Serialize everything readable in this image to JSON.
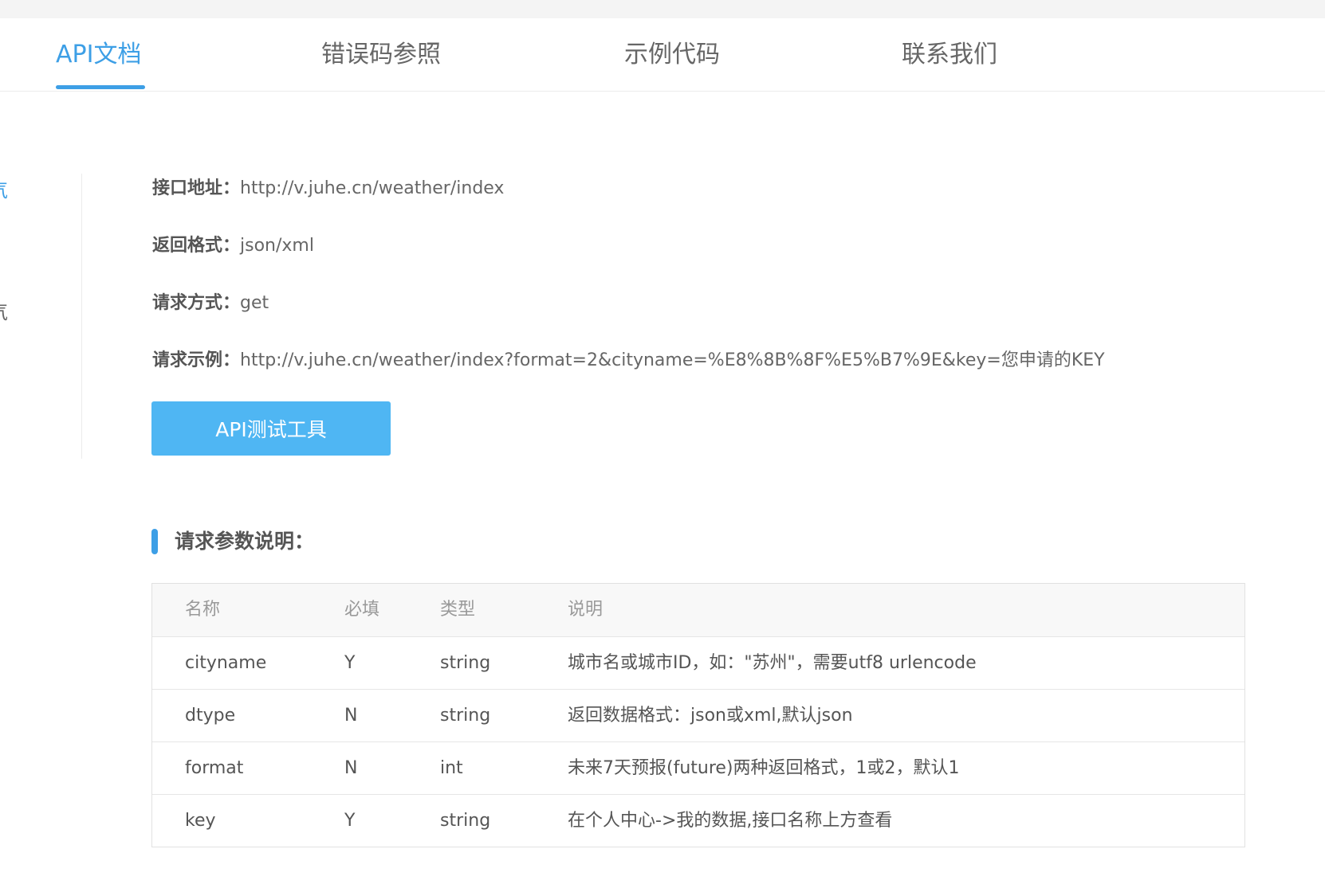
{
  "tabs": [
    {
      "label": "API文档",
      "active": true
    },
    {
      "label": "错误码参照",
      "active": false
    },
    {
      "label": "示例代码",
      "active": false
    },
    {
      "label": "联系我们",
      "active": false
    }
  ],
  "sidebar": {
    "items": [
      {
        "label": "气",
        "active": true
      },
      {
        "label": "气",
        "active": false
      }
    ]
  },
  "api_info": {
    "address_label": "接口地址：",
    "address_value": "http://v.juhe.cn/weather/index",
    "format_label": "返回格式：",
    "format_value": "json/xml",
    "method_label": "请求方式：",
    "method_value": "get",
    "example_label": "请求示例：",
    "example_value": "http://v.juhe.cn/weather/index?format=2&cityname=%E8%8B%8F%E5%B7%9E&key=您申请的KEY"
  },
  "test_button_label": "API测试工具",
  "params_section": {
    "title": "请求参数说明：",
    "headers": [
      "名称",
      "必填",
      "类型",
      "说明"
    ],
    "rows": [
      [
        "cityname",
        "Y",
        "string",
        "城市名或城市ID，如：\"苏州\"，需要utf8 urlencode"
      ],
      [
        "dtype",
        "N",
        "string",
        "返回数据格式：json或xml,默认json"
      ],
      [
        "format",
        "N",
        "int",
        "未来7天预报(future)两种返回格式，1或2，默认1"
      ],
      [
        "key",
        "Y",
        "string",
        "在个人中心->我的数据,接口名称上方查看"
      ]
    ]
  },
  "colors": {
    "accent": "#3d9fe6",
    "button": "#4fb6f3",
    "table_header_bg": "#f8f8f8"
  }
}
